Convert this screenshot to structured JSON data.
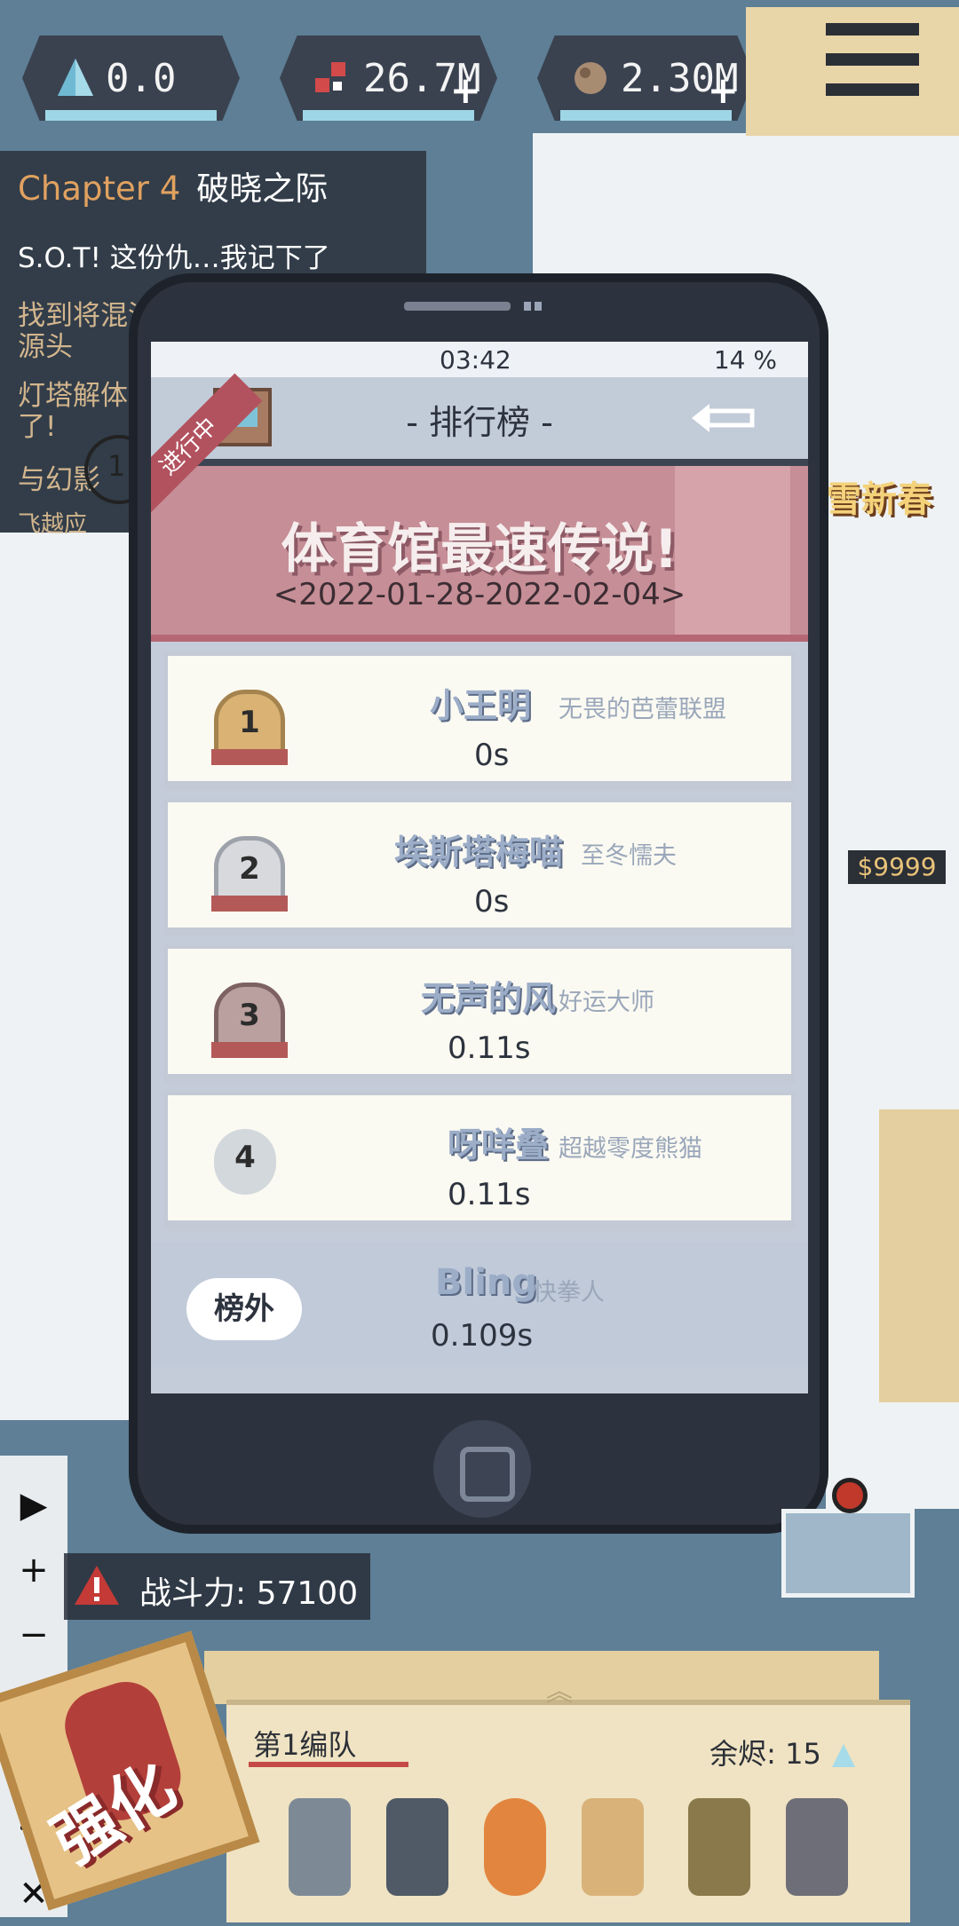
{
  "colors": {
    "accent_chapter": "#e0a160",
    "banner": "#c68e96",
    "ribbon": "#b2525f",
    "panel_dark": "#2d333e"
  },
  "currencies": [
    {
      "icon": "crystal-icon",
      "value": "0.0",
      "has_plus": false
    },
    {
      "icon": "parts-icon",
      "value": "26.7M",
      "has_plus": true
    },
    {
      "icon": "ore-icon",
      "value": "2.30M",
      "has_plus": true
    }
  ],
  "chapter": {
    "chapter_label": "Chapter 4",
    "chapter_title": "破晓之际",
    "lines": [
      "S.O.T! 这份仇…我记下了",
      "找到将混沌",
      "源头",
      "灯塔解体",
      "了!",
      "与幻影",
      "飞越应"
    ]
  },
  "map_marker": {
    "number": "1"
  },
  "event_banner_side": "雪新春",
  "shop_sign": "$9999",
  "phone": {
    "status_time": "03:42",
    "battery": "14 %",
    "nav_title": "- 排行榜 -",
    "ribbon": "进行中",
    "event_title": "体育馆最速传说!",
    "event_dates": "<2022-01-28-2022-02-04>",
    "rows": [
      {
        "rank": "1",
        "name": "小王明",
        "guild": "无畏的芭蕾联盟",
        "time": "0s"
      },
      {
        "rank": "2",
        "name": "埃斯塔梅喵",
        "guild": "至冬懦夫",
        "time": "0s"
      },
      {
        "rank": "3",
        "name": "无声的风",
        "guild": "好运大师",
        "time": "0.11s"
      },
      {
        "rank": "4",
        "name": "呀咩叠",
        "guild": "超越零度熊猫",
        "time": "0.11s"
      }
    ],
    "self": {
      "label": "榜外",
      "name": "Bling",
      "guild": "快拳人",
      "time": "0.109s"
    }
  },
  "power": {
    "label": "战斗力:",
    "value": "57100"
  },
  "toolbar": [
    "▶",
    "+",
    "−",
    "⚙",
    "👁",
    "✥",
    "✕"
  ],
  "team": {
    "name": "第1编队",
    "ember_label": "余烬:",
    "ember_value": "15"
  },
  "enhance_label": "强化"
}
